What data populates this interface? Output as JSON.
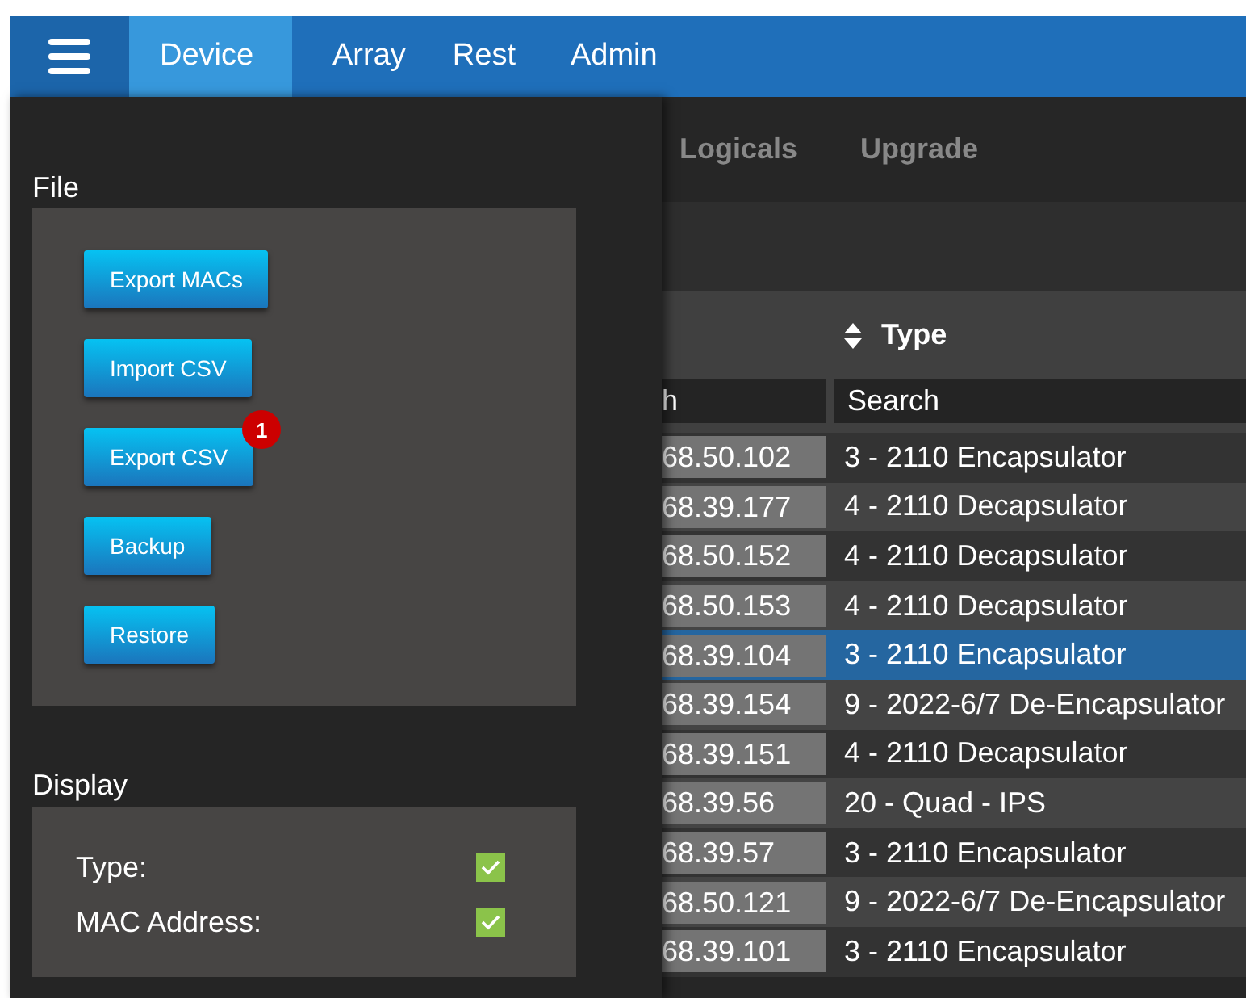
{
  "nav": {
    "tabs": [
      {
        "label": "Device",
        "selected": true
      },
      {
        "label": "Array",
        "selected": false
      },
      {
        "label": "Rest",
        "selected": false
      },
      {
        "label": "Admin",
        "selected": false
      }
    ]
  },
  "subtabs": [
    {
      "label": "Logicals",
      "selected": false
    },
    {
      "label": "Upgrade",
      "selected": false
    }
  ],
  "drawer": {
    "file": {
      "title": "File",
      "buttons": [
        {
          "label": "Export MACs"
        },
        {
          "label": "Import CSV"
        },
        {
          "label": "Export CSV",
          "badge": "1"
        },
        {
          "label": "Backup"
        },
        {
          "label": "Restore"
        }
      ]
    },
    "display": {
      "title": "Display",
      "options": [
        {
          "label": "Type:",
          "checked": true
        },
        {
          "label": "MAC Address:",
          "checked": true
        }
      ]
    }
  },
  "table": {
    "columns": [
      {
        "placeholder": "h"
      },
      {
        "label": "Type",
        "placeholder": "Search"
      }
    ],
    "rows": [
      {
        "cells": [
          "68.50.102",
          "3 - 2110 Encapsulator"
        ],
        "selected": false
      },
      {
        "cells": [
          "68.39.177",
          "4 - 2110 Decapsulator"
        ],
        "selected": false
      },
      {
        "cells": [
          "68.50.152",
          "4 - 2110 Decapsulator"
        ],
        "selected": false
      },
      {
        "cells": [
          "68.50.153",
          "4 - 2110 Decapsulator"
        ],
        "selected": false
      },
      {
        "cells": [
          "68.39.104",
          "3 - 2110 Encapsulator"
        ],
        "selected": true
      },
      {
        "cells": [
          "68.39.154",
          "9 - 2022-6/7 De-Encapsulator"
        ],
        "selected": false
      },
      {
        "cells": [
          "68.39.151",
          "4 - 2110 Decapsulator"
        ],
        "selected": false
      },
      {
        "cells": [
          "68.39.56",
          "20 - Quad - IPS"
        ],
        "selected": false
      },
      {
        "cells": [
          "68.39.57",
          "3 - 2110 Encapsulator"
        ],
        "selected": false
      },
      {
        "cells": [
          "68.50.121",
          "9 - 2022-6/7 De-Encapsulator"
        ],
        "selected": false
      },
      {
        "cells": [
          "68.39.101",
          "3 - 2110 Encapsulator"
        ],
        "selected": false
      }
    ]
  }
}
